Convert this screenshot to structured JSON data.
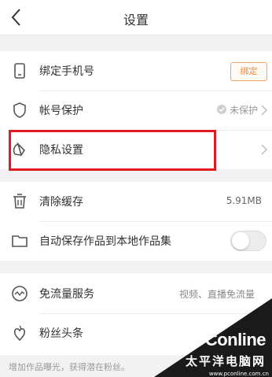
{
  "header": {
    "title": "设置"
  },
  "account_group": {
    "items": [
      {
        "label": "绑定手机号",
        "button": "绑定",
        "icon": "phone-icon"
      },
      {
        "label": "帐号保护",
        "status": "未保护",
        "icon": "shield-icon"
      },
      {
        "label": "隐私设置",
        "icon": "privacy-icon"
      }
    ]
  },
  "storage_group": {
    "items": [
      {
        "label": "清除缓存",
        "value": "5.91MB",
        "icon": "trash-icon"
      },
      {
        "label": "自动保存作品到本地作品集",
        "toggle_on": false,
        "icon": "folder-icon"
      }
    ]
  },
  "service_group": {
    "items": [
      {
        "label": "免流量服务",
        "value": "视频、直播免流量",
        "icon": "traffic-icon"
      },
      {
        "label": "粉丝头条",
        "icon": "fans-icon"
      }
    ],
    "note": "增加作品曝光，获得潜在粉丝。"
  },
  "watermark": {
    "logo": "PConline",
    "cn": "太平洋电脑网",
    "domain": "www.pconline.com.cn"
  },
  "colors": {
    "accent": "#f08a3c",
    "highlight": "#e01b24"
  }
}
